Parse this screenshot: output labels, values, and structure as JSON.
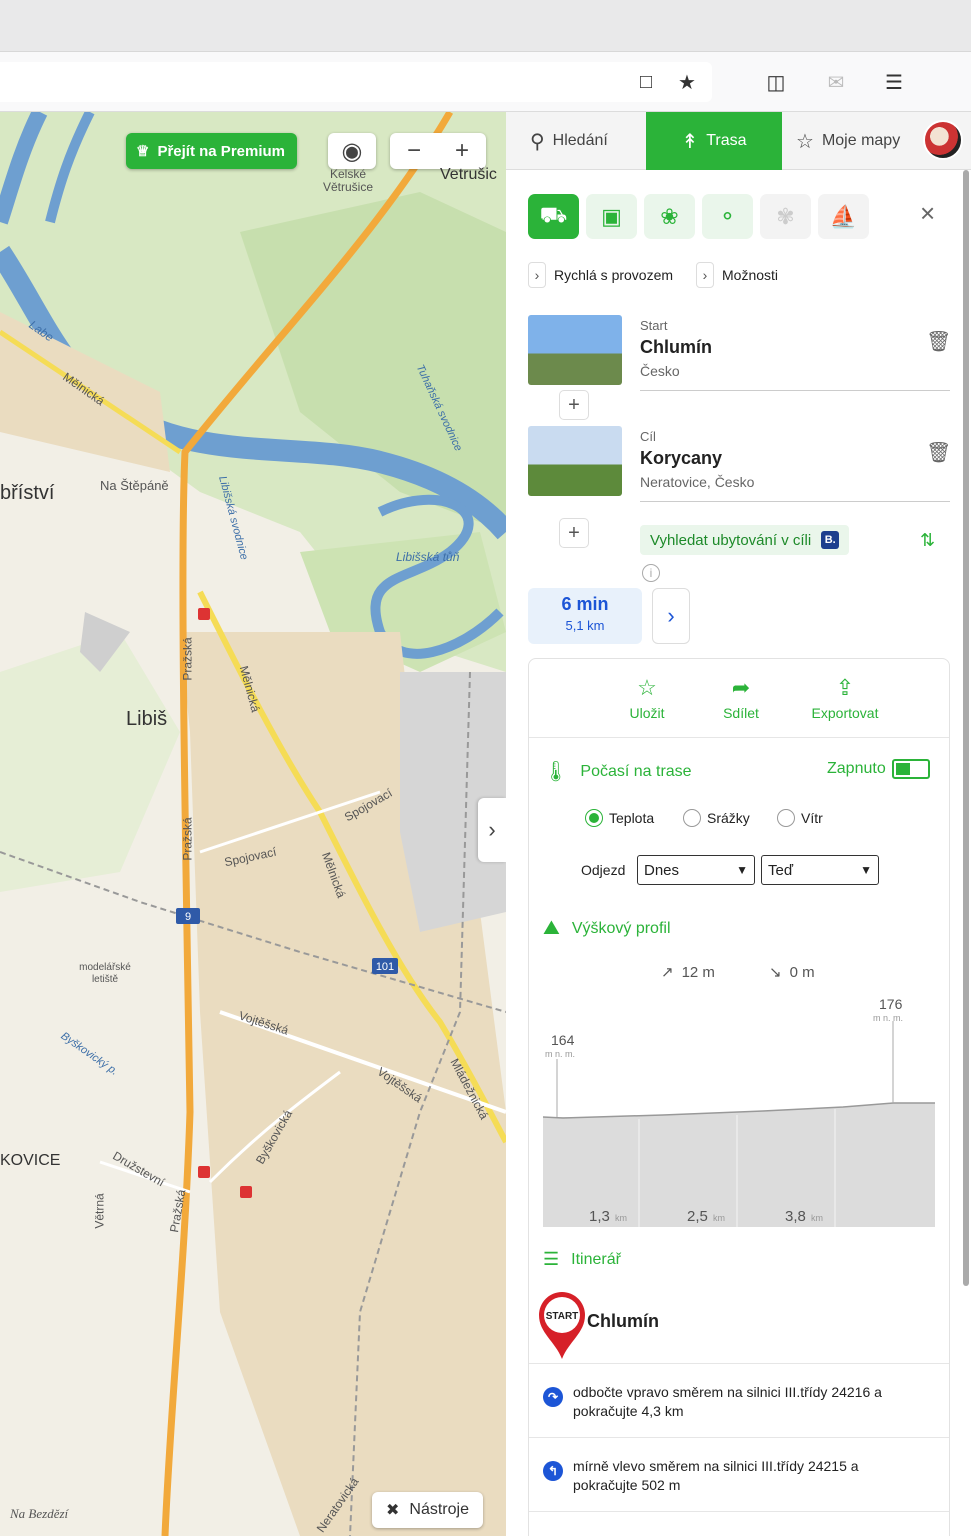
{
  "map": {
    "premium_label": "Přejít na Premium",
    "tools_label": "Nástroje",
    "labels": {
      "kelske": "Kelské Větrušice",
      "vetrusic": "Vetrušic",
      "labe": "Labe",
      "melnicka1": "Mělnická",
      "bristvi": "bříství",
      "na_stepane": "Na Štěpáně",
      "libis": "Libiš",
      "libisska_tun": "Libišská tůň",
      "tuharska": "Tuhaňská svodnice",
      "libisska_svodnice": "Libišská svodnice",
      "prazska1": "Pražská",
      "prazska2": "Pražská",
      "melnicka2": "Mělnická",
      "melnicka3": "Mělnická",
      "spojovaci1": "Spojovací",
      "spojovaci2": "Spojovací",
      "modelarske": "modelářské letiště",
      "vojtesska1": "Vojtěšská",
      "vojtesska2": "Vojtěšská",
      "mladeznicka": "Mládežnická",
      "byskovicky": "Byškovický p.",
      "byskovicka": "Byškovická",
      "kovice": "KOVICE",
      "druzstevni": "Družstevní",
      "vetrna": "Větrná",
      "prazska3": "Pražská",
      "na_bezdezi": "Na Bezdězí",
      "neratovicka": "Neratovická",
      "road9": "9",
      "road101": "101"
    }
  },
  "panel": {
    "tabs": {
      "search": "Hledání",
      "route": "Trasa",
      "mymaps": "Moje mapy"
    },
    "options": {
      "fast": "Rychlá s provozem",
      "more": "Možnosti"
    },
    "start": {
      "label": "Start",
      "name": "Chlumín",
      "sub": "Česko"
    },
    "end": {
      "label": "Cíl",
      "name": "Korycany",
      "sub": "Neratovice, Česko"
    },
    "accommodation": "Vyhledat ubytování v cíli",
    "accommodation_badge": "B.",
    "summary": {
      "time": "6 min",
      "distance": "5,1 km"
    },
    "actions": {
      "save": "Uložit",
      "share": "Sdílet",
      "export": "Exportovat"
    },
    "weather": {
      "title": "Počasí na trase",
      "toggle": "Zapnuto",
      "radios": [
        "Teplota",
        "Srážky",
        "Vítr"
      ],
      "depart_label": "Odjezd",
      "day": "Dnes",
      "time": "Teď"
    },
    "elevation": {
      "title": "Výškový profil",
      "ascent": "12 m",
      "descent": "0 m",
      "min": "164",
      "max": "176",
      "unit": "m n. m.",
      "ticks": [
        "1,3",
        "2,5",
        "3,8"
      ],
      "tick_unit": "km"
    },
    "itinerary": {
      "title": "Itinerář",
      "start_badge": "START",
      "start_name": "Chlumín",
      "steps": [
        "odbočte vpravo směrem na silnici III.třídy 24216 a pokračujte 4,3 km",
        "mírně vlevo směrem na silnici III.třídy 24215 a pokračujte 502 m"
      ]
    }
  }
}
